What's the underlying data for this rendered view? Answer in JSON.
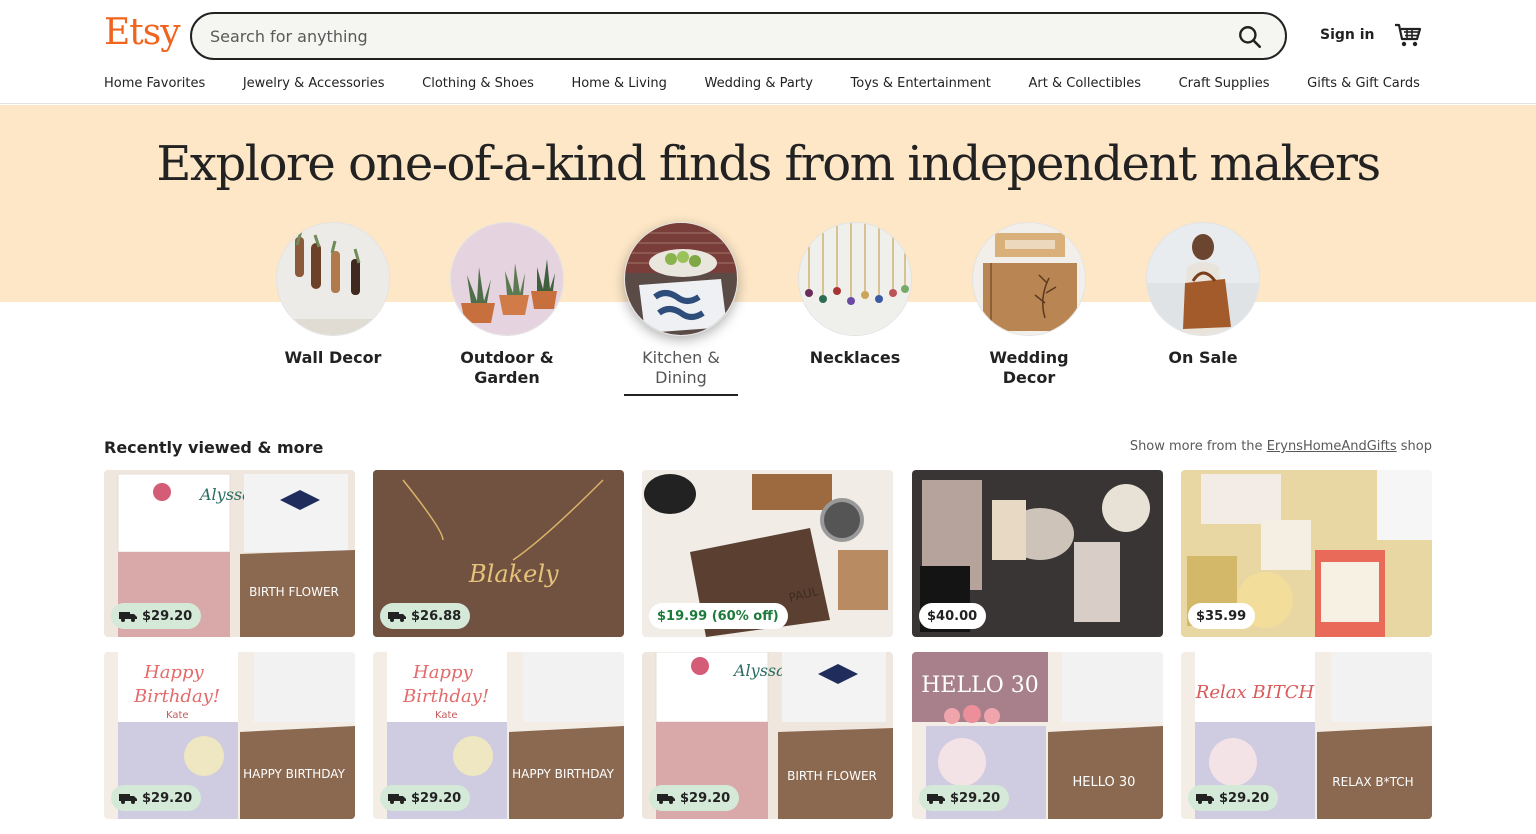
{
  "header": {
    "logo": "Etsy",
    "search_placeholder": "Search for anything",
    "signin": "Sign in"
  },
  "nav": [
    "Home Favorites",
    "Jewelry & Accessories",
    "Clothing & Shoes",
    "Home & Living",
    "Wedding & Party",
    "Toys & Entertainment",
    "Art & Collectibles",
    "Craft Supplies",
    "Gifts & Gift Cards"
  ],
  "hero": {
    "title": "Explore one-of-a-kind finds from independent makers",
    "categories": [
      {
        "line1": "Wall Decor",
        "line2": ""
      },
      {
        "line1": "Outdoor &",
        "line2": "Garden"
      },
      {
        "line1": "Kitchen &",
        "line2": "Dining"
      },
      {
        "line1": "Necklaces",
        "line2": ""
      },
      {
        "line1": "Wedding",
        "line2": "Decor"
      },
      {
        "line1": "On Sale",
        "line2": ""
      }
    ]
  },
  "section": {
    "title": "Recently viewed & more",
    "more_prefix": "Show more from the ",
    "more_shop": "ErynsHomeAndGifts",
    "more_suffix": " shop"
  },
  "products": [
    {
      "price": "$29.20",
      "shipping": true,
      "label": "BIRTH FLOWER",
      "name": "Alyssa"
    },
    {
      "price": "$26.88",
      "shipping": true,
      "label": "",
      "name": "Blakely"
    },
    {
      "price": "$19.99 (60% off)",
      "shipping": false,
      "label": "",
      "name": "PAUL"
    },
    {
      "price": "$40.00",
      "shipping": false,
      "label": "",
      "name": ""
    },
    {
      "price": "$35.99",
      "shipping": false,
      "label": "",
      "name": ""
    },
    {
      "price": "$29.20",
      "shipping": true,
      "label": "HAPPY BIRTHDAY",
      "name": "Kate"
    },
    {
      "price": "$29.20",
      "shipping": true,
      "label": "HAPPY BIRTHDAY",
      "name": "Kate"
    },
    {
      "price": "$29.20",
      "shipping": true,
      "label": "BIRTH FLOWER",
      "name": "Alyssa"
    },
    {
      "price": "$29.20",
      "shipping": true,
      "label": "HELLO 30",
      "name": "HELLO 30"
    },
    {
      "price": "$29.20",
      "shipping": true,
      "label": "RELAX B*TCH",
      "name": "Relax BITCH"
    }
  ],
  "colors": {
    "brand": "#f1641e",
    "hero_bg": "#fde7c7",
    "shipping_badge": "#d4e9d7",
    "sale_text": "#1e7a3a"
  }
}
